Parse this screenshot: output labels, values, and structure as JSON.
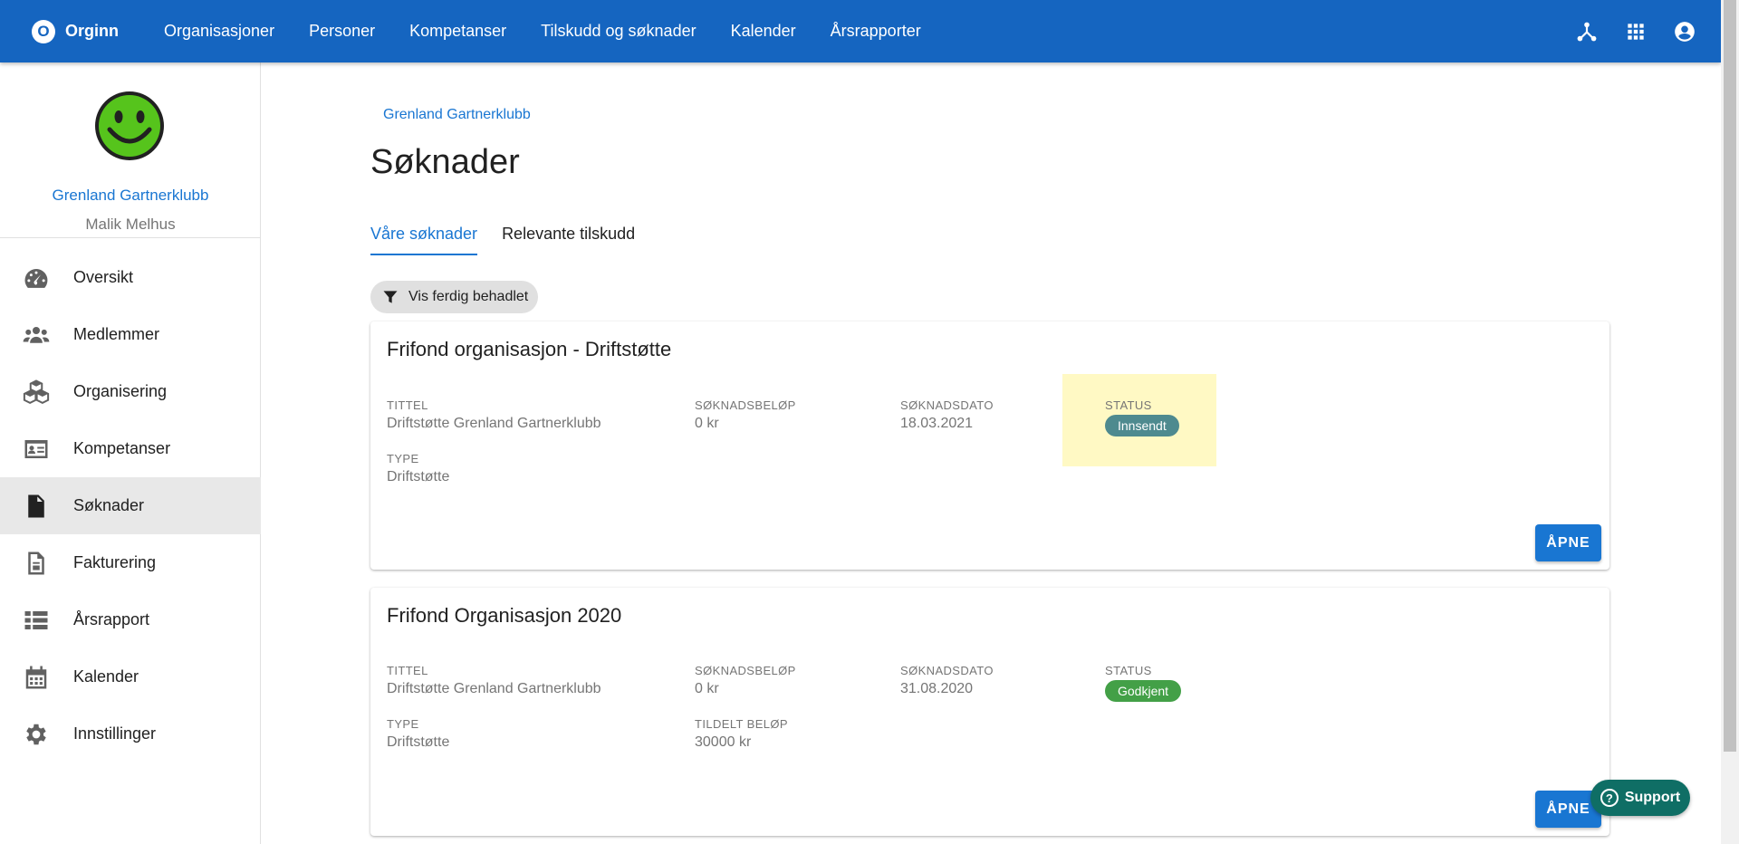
{
  "topbar": {
    "brand_letter": "O",
    "brand_name": "Orginn",
    "nav": [
      "Organisasjoner",
      "Personer",
      "Kompetanser",
      "Tilskudd og søknader",
      "Kalender",
      "Årsrapporter"
    ],
    "icons": [
      "network-icon",
      "apps-grid-icon",
      "account-circle-icon"
    ],
    "color": "#1565c0"
  },
  "sidebar": {
    "avatar": "smiley-face-avatar",
    "org_name": "Grenland Gartnerklubb",
    "user_name": "Malik Melhus",
    "items": [
      {
        "label": "Oversikt",
        "icon": "dashboard-icon"
      },
      {
        "label": "Medlemmer",
        "icon": "people-icon"
      },
      {
        "label": "Organisering",
        "icon": "cubes-icon"
      },
      {
        "label": "Kompetanser",
        "icon": "id-card-icon"
      },
      {
        "label": "Søknader",
        "icon": "document-icon",
        "active": true
      },
      {
        "label": "Fakturering",
        "icon": "invoice-icon"
      },
      {
        "label": "Årsrapport",
        "icon": "list-icon"
      },
      {
        "label": "Kalender",
        "icon": "calendar-icon"
      },
      {
        "label": "Innstillinger",
        "icon": "gear-icon"
      }
    ]
  },
  "main": {
    "breadcrumb": "Grenland Gartnerklubb",
    "title": "Søknader",
    "tabs": [
      {
        "label": "Våre søknader",
        "active": true
      },
      {
        "label": "Relevante tilskudd"
      }
    ],
    "filter_label": "Vis ferdig behadlet",
    "labels": {
      "title": "Tittel",
      "amount": "Søknadsbeløp",
      "date": "Søknadsdato",
      "status": "Status",
      "type": "Type",
      "granted": "Tildelt beløp"
    },
    "cards": [
      {
        "heading": "Frifond organisasjon - Driftstøtte",
        "title": "Driftstøtte Grenland Gartnerklubb",
        "amount": "0 kr",
        "date": "18.03.2021",
        "status": "Innsendt",
        "status_color": "#4e8a8f",
        "type": "Driftstøtte",
        "open_label": "Åpne"
      },
      {
        "heading": "Frifond Organisasjon 2020",
        "title": "Driftstøtte Grenland Gartnerklubb",
        "amount": "0 kr",
        "date": "31.08.2020",
        "status": "Godkjent",
        "status_color": "#43a047",
        "type": "Driftstøtte",
        "granted": "30000 kr",
        "open_label": "Åpne"
      }
    ]
  },
  "support": {
    "label": "Support",
    "icon": "question-circle-icon"
  }
}
